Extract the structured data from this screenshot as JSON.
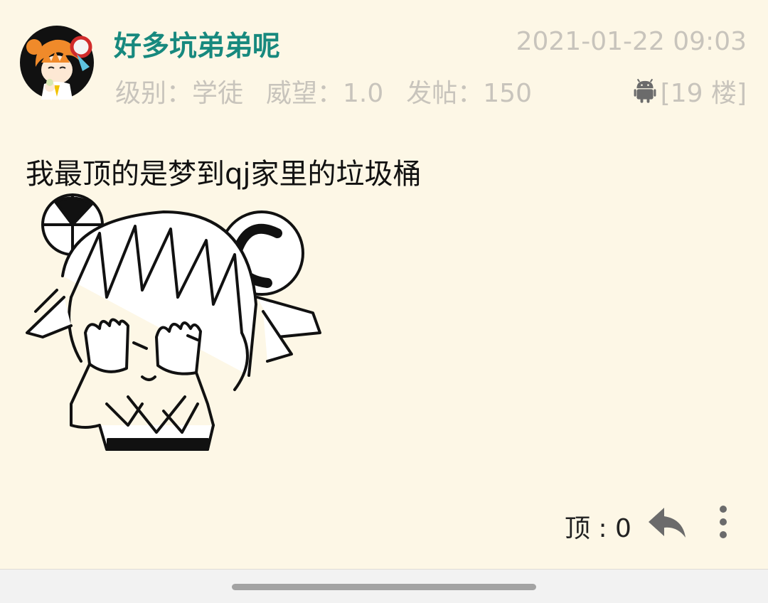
{
  "post": {
    "username": "好多坑弟弟呢",
    "timestamp": "2021-01-22 09:03",
    "level": "级别：学徒",
    "prestige": "威望：1.0",
    "posts_count": "发帖：150",
    "floor": "[19 楼]",
    "device_icon": "android-icon",
    "content_text": "我最顶的是梦到qj家里的垃圾桶",
    "upvote_label": "顶 : 0"
  },
  "colors": {
    "background": "#fdf7e6",
    "username": "#17897e",
    "meta": "#c8c4bc",
    "icon": "#6b6b6b"
  }
}
